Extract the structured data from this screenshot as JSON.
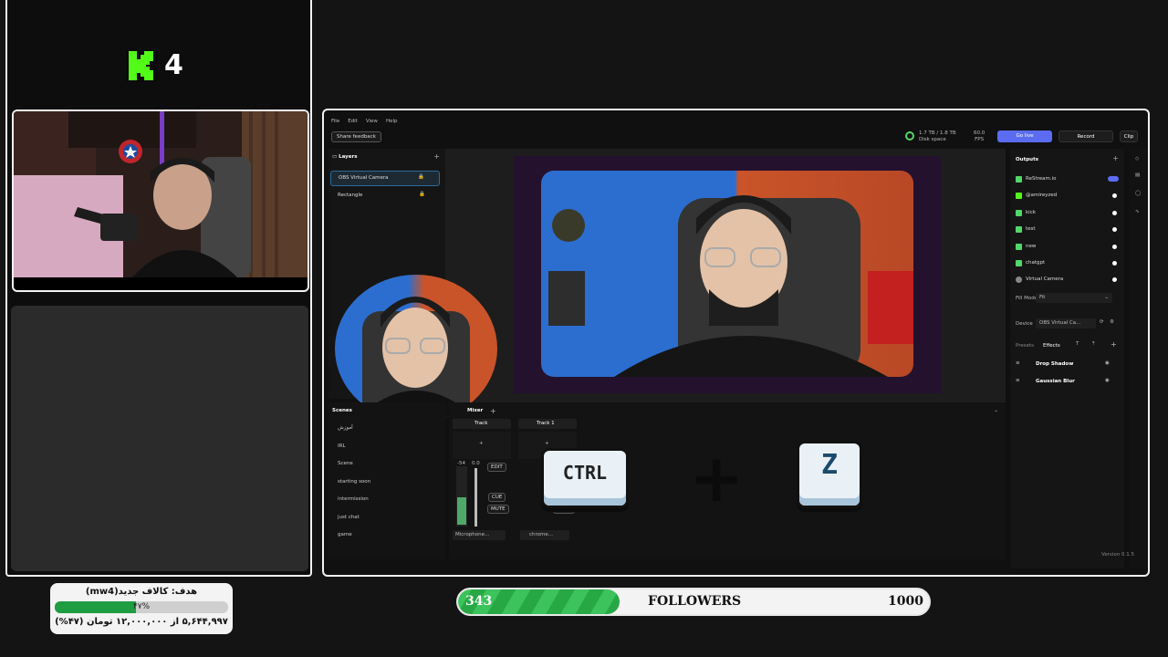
{
  "kick_badge": {
    "letter": "K",
    "number": "4"
  },
  "donation_goal": {
    "title": "هدف: کالاف جدید(mw4)",
    "percent": 47,
    "percent_label": "۴۷%",
    "amount_text": "۵,۶۴۴,۹۹۷ از ۱۲,۰۰۰,۰۰۰ تومان (۴۷%)"
  },
  "followers": {
    "current": "343",
    "label": "FOLLOWERS",
    "goal": "1000",
    "progress": 0.343
  },
  "obs": {
    "menu": [
      "File",
      "Edit",
      "View",
      "Help"
    ],
    "share_feedback": "Share feedback",
    "disk_space_value": "1.7 TB / 1.8 TB",
    "disk_space_label": "Disk space",
    "fps_value": "60.0",
    "fps_label": "FPS",
    "go_live": "Go live",
    "record": "Record",
    "clip": "Clip",
    "layers_title": "Layers",
    "layers": [
      "OBS Virtual Camera",
      "Rectangle"
    ],
    "outputs_title": "Outputs",
    "outputs": [
      "ReStream.io",
      "@amireyzed",
      "kick",
      "test",
      "new",
      "chatgpt",
      "Virtual Camera"
    ],
    "fill_mode_label": "Fill Mode",
    "fill_mode_value": "Fit",
    "device_label": "Device",
    "device_value": "OBS Virtual Ca...",
    "tabs": [
      "Presets",
      "Effects"
    ],
    "effects": [
      "Drop Shadow",
      "Gaussian Blur"
    ],
    "scenes_title": "Scenes",
    "scenes": [
      "آموزش",
      "IRL",
      "Scene",
      "starting soon",
      "intermission",
      "just chat",
      "game"
    ],
    "mixer_title": "Mixer",
    "tracks": [
      {
        "name": "Track",
        "db": "-54",
        "db2": "0.0",
        "edit": "EDIT",
        "cue": "CUE",
        "mute": "MUTE",
        "source": "Microphone..."
      },
      {
        "name": "Track 1",
        "source": "chrome...",
        "mute": "MUTE"
      }
    ],
    "version": "Version 0.1.5"
  },
  "keys": {
    "ctrl": "CTRL",
    "z": "Z",
    "plus": "+"
  },
  "colors": {
    "kick_green": "#53fc18",
    "go_live": "#5b6cf0",
    "progress_green": "#27a845"
  }
}
